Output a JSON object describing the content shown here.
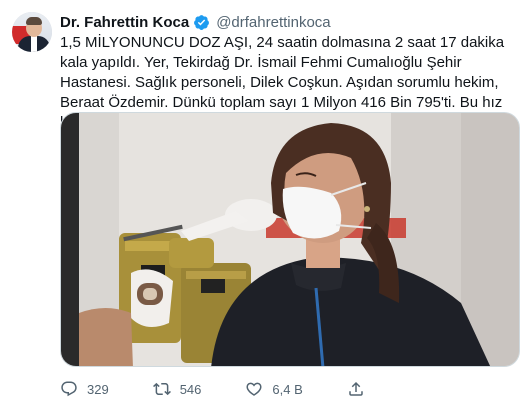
{
  "tweet": {
    "author_name": "Dr. Fahrettin Koca",
    "handle": "@drfahrettinkoca",
    "text": "1,5 MİLYONUNCU DOZ AŞI, 24 saatin dolmasına 2 saat 17 dakika kala yapıldı. Yer, Tekirdağ Dr. İsmail Fehmi Cumalıoğlu Şehir Hastanesi. Sağlık personeli, Dilek Coşkun. Aşıdan sorumlu hekim, Beraat Özdemir. Dünkü toplam sayı 1 Milyon 416 Bin 795'ti. Bu hız bu işi erkenden bitirecek.",
    "media_icon": "video-still-vaccination",
    "actions": {
      "reply_count": "329",
      "retweet_count": "546",
      "like_count": "6,4 B"
    }
  },
  "colors": {
    "text": "#0f1419",
    "secondary": "#536471",
    "verified": "#1d9bf0",
    "retweet_active": "#00ba7c"
  }
}
